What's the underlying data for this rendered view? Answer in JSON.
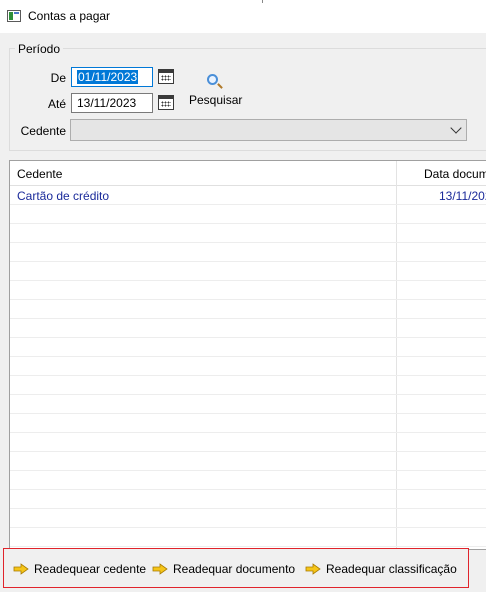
{
  "window": {
    "title": "Contas a pagar",
    "icon": "window-app-icon"
  },
  "periodo": {
    "group_label": "Período",
    "de_label": "De",
    "de_value": "01/11/2023",
    "ate_label": "Até",
    "ate_value": "13/11/2023",
    "calendar_icon": "calendar-icon",
    "search_label": "Pesquisar",
    "search_icon": "magnifier-icon"
  },
  "cedente": {
    "label": "Cedente",
    "selected": ""
  },
  "grid": {
    "columns": [
      "Cedente",
      "Data docum"
    ],
    "rows": [
      {
        "cedente": "Cartão de crédito",
        "data": "13/11/202"
      }
    ]
  },
  "actions": [
    {
      "label": "Readequear cedente",
      "icon": "arrow-right-icon"
    },
    {
      "label": "Readequar documento",
      "icon": "arrow-right-icon"
    },
    {
      "label": "Readequar classificação",
      "icon": "arrow-right-icon"
    }
  ],
  "colors": {
    "selection": "#0078d7",
    "row_text": "#1a2a9a",
    "highlight_border": "#e0242b",
    "arrow_fill": "#f5c518"
  }
}
